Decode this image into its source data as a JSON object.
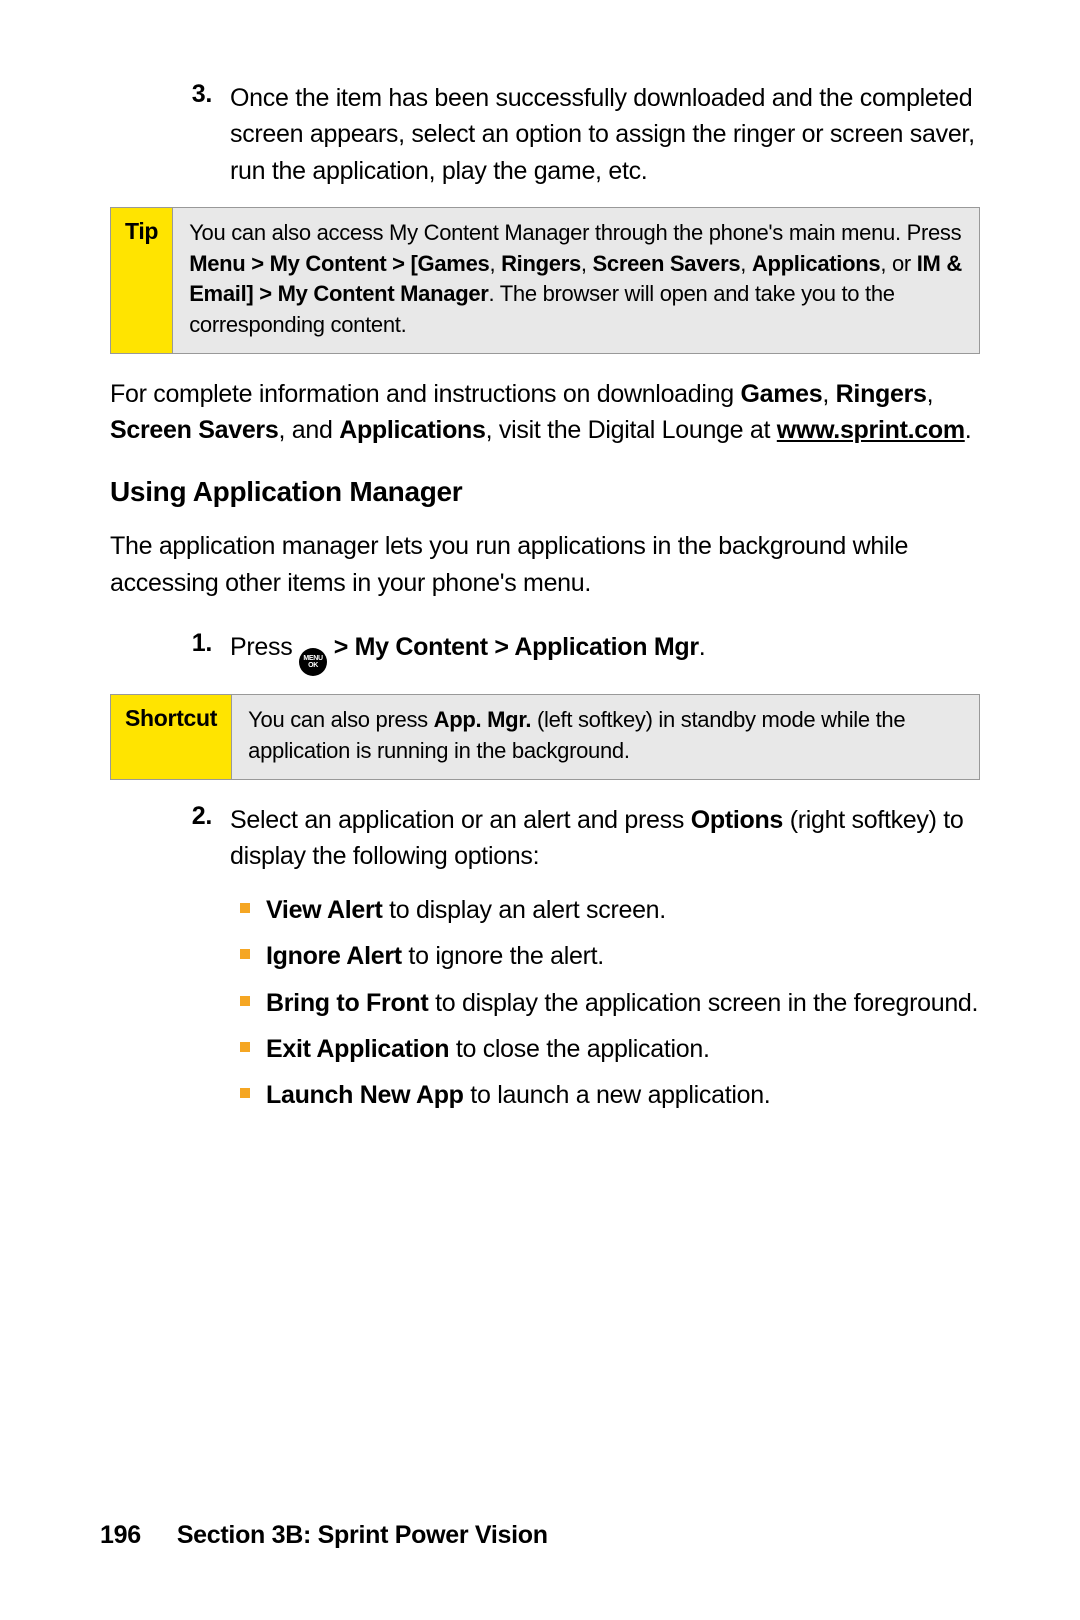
{
  "step3": {
    "num": "3.",
    "text": "Once the item has been successfully downloaded and the completed screen appears, select an option to assign the ringer or screen saver, run the application, play the game, etc."
  },
  "tip": {
    "label": "Tip",
    "pre": "You can also access My Content Manager through the phone's main menu. Press ",
    "bold1": "Menu > My Content > [Games",
    "mid1": ", ",
    "bold2": "Ringers",
    "mid2": ", ",
    "bold3": "Screen Savers",
    "mid3": ", ",
    "bold4": "Applications",
    "mid4": ", or ",
    "bold5": "IM & Email] > My Content Manager",
    "post": ". The browser will open and take you to the corresponding content."
  },
  "para1": {
    "pre": "For complete information and instructions on downloading ",
    "b1": "Games",
    "m1": ", ",
    "b2": "Ringers",
    "m2": ", ",
    "b3": "Screen Savers",
    "m3": ", and ",
    "b4": "Applications",
    "post": ", visit the Digital Lounge at ",
    "link": "www.sprint.com",
    "end": "."
  },
  "h3": "Using Application Manager",
  "para2": "The application manager lets you run applications in the background while accessing other items in your phone's menu.",
  "step1": {
    "num": "1.",
    "pre": "Press ",
    "icon_top": "MENU",
    "icon_bot": "OK",
    "bold": " > My Content > Application Mgr",
    "end": "."
  },
  "shortcut": {
    "label": "Shortcut",
    "pre": "You can also press ",
    "bold": "App. Mgr.",
    "post": " (left softkey) in standby mode while the application is running in the background."
  },
  "step2": {
    "num": "2.",
    "pre": "Select an application or an alert and press ",
    "bold": "Options",
    "post": " (right softkey) to display the following options:"
  },
  "bullets": [
    {
      "b": "View Alert",
      "t": " to display an alert screen."
    },
    {
      "b": "Ignore Alert",
      "t": " to ignore the alert."
    },
    {
      "b": "Bring to Front",
      "t": " to display the application screen in the foreground."
    },
    {
      "b": "Exit Application",
      "t": " to close the application."
    },
    {
      "b": "Launch New App",
      "t": " to launch a new application."
    }
  ],
  "footer": {
    "page": "196",
    "section": "Section 3B: Sprint Power Vision"
  }
}
